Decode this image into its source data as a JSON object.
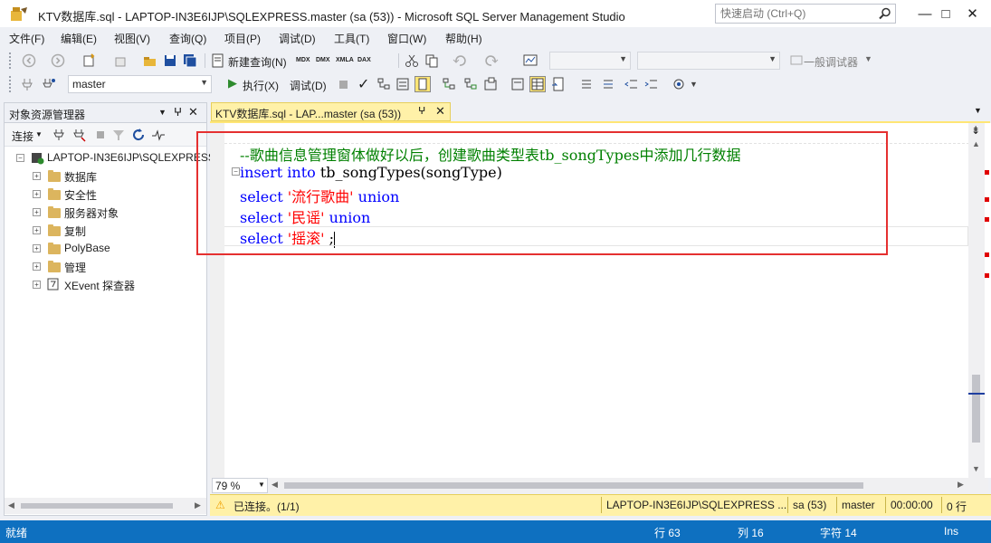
{
  "window": {
    "title": "KTV数据库.sql - LAPTOP-IN3E6IJP\\SQLEXPRESS.master (sa (53)) - Microsoft SQL Server Management Studio",
    "quick_launch_placeholder": "快速启动 (Ctrl+Q)",
    "controls": {
      "minimize": "—",
      "maximize": "□",
      "close": "✕"
    }
  },
  "menu": [
    "文件(F)",
    "编辑(E)",
    "视图(V)",
    "查询(Q)",
    "项目(P)",
    "调试(D)",
    "工具(T)",
    "窗口(W)",
    "帮助(H)"
  ],
  "toolbar1": {
    "new_query": "新建查询(N)",
    "mdx": "MDX",
    "dmx": "DMX",
    "xmla": "XMLA",
    "dax": "DAX",
    "debugger_label": "一般调试器"
  },
  "toolbar2": {
    "database": "master",
    "execute": "执行(X)",
    "debug": "调试(D)"
  },
  "object_explorer": {
    "title": "对象资源管理器",
    "connect": "连接",
    "server": "LAPTOP-IN3E6IJP\\SQLEXPRESS",
    "nodes": [
      "数据库",
      "安全性",
      "服务器对象",
      "复制",
      "PolyBase",
      "管理",
      "XEvent 探查器"
    ]
  },
  "editor": {
    "tab_title": "KTV数据库.sql - LAP...master (sa (53))",
    "lines": [
      {
        "comment": "--歌曲信息管理窗体做好以后，创建歌曲类型表tb_songTypes中添加几行数据"
      },
      {
        "kw1": "insert",
        "kw2": "into",
        "rest": " tb_songTypes(songType)"
      },
      {
        "kw1": "select",
        "str": "'流行歌曲'",
        "kw2": "union"
      },
      {
        "kw1": "select",
        "str": "'民谣'",
        "kw2": "union"
      },
      {
        "kw1": "select",
        "str": "'摇滚'",
        "rest": " ;"
      }
    ],
    "zoom": "79 %"
  },
  "query_status": {
    "connected": "已连接。(1/1)",
    "server": "LAPTOP-IN3E6IJP\\SQLEXPRESS ...",
    "user": "sa (53)",
    "database": "master",
    "elapsed": "00:00:00",
    "rows": "0 行"
  },
  "status_bar": {
    "ready": "就绪",
    "line": "行 63",
    "col": "列 16",
    "char": "字符 14",
    "mode": "Ins"
  },
  "colors": {
    "keyword": "#0000ff",
    "string": "#ff0000",
    "comment": "#008000",
    "status_bar": "#0e70c0",
    "tab_active": "#fff1a8",
    "highlight_box": "#e53030"
  }
}
